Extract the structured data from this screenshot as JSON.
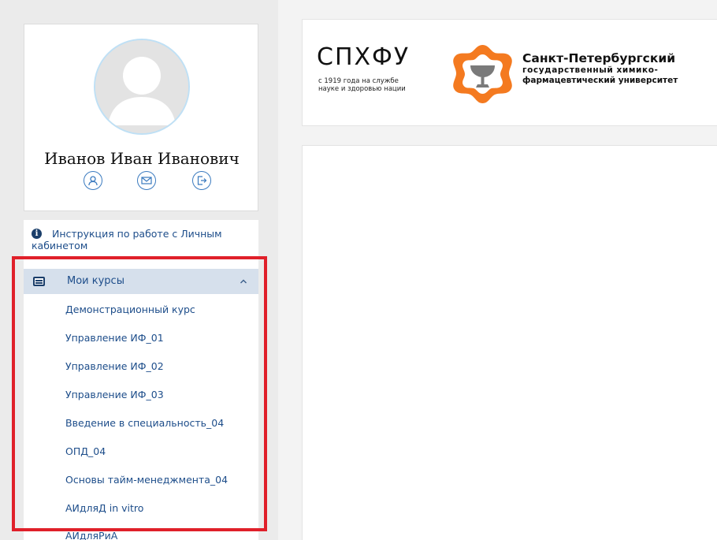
{
  "profile": {
    "name": "Иванов Иван Иванович",
    "avatar_icon": "user-silhouette-icon",
    "actions": [
      {
        "icon": "user-icon"
      },
      {
        "icon": "mail-icon"
      },
      {
        "icon": "logout-icon"
      }
    ]
  },
  "menu": {
    "instruction": {
      "icon": "info-icon",
      "label": "Инструкция по работе с Личным кабинетом"
    },
    "courses": {
      "icon": "list-icon",
      "title": "Мои курсы",
      "expanded": true,
      "items": [
        "Демонстрационный курс",
        "Управление ИФ_01",
        "Управление ИФ_02",
        "Управление ИФ_03",
        "Введение в специальность_04",
        "ОПД_04",
        "Основы тайм-менеджмента_04",
        "АИдляД in vitro",
        "АИдляРиА"
      ]
    }
  },
  "header": {
    "logo_abbr": "СПХФУ",
    "logo_motto": "с 1919 года на службе\nнауке и здоровью нации",
    "uni_line1": "Санкт-Петербургский",
    "uni_line2": "государственный химико-",
    "uni_line3": "фармацевтический университет"
  },
  "colors": {
    "accent": "#1d4d8a",
    "active_bg": "#d6e0ec",
    "highlight": "#e0202a",
    "emblem": "#f47a20",
    "sidebar_bg": "#ebebeb"
  }
}
